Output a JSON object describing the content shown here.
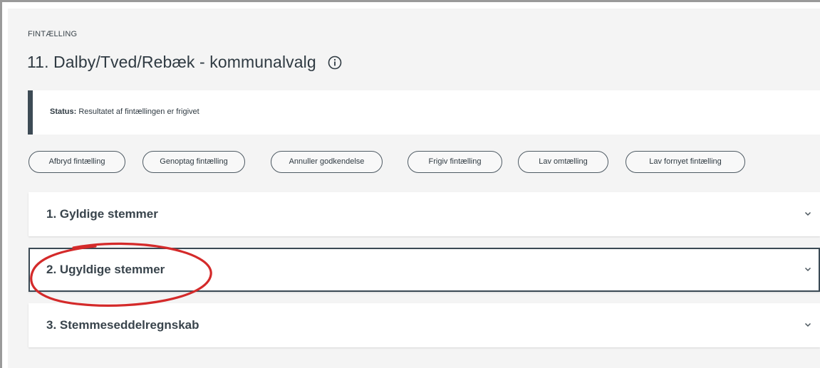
{
  "header": {
    "eyebrow": "FINTÆLLING",
    "title": "11. Dalby/Tved/Rebæk - kommunalvalg"
  },
  "status": {
    "label": "Status:",
    "text": " Resultatet af fintællingen er frigivet"
  },
  "actions": [
    {
      "label": "Afbryd fintælling"
    },
    {
      "label": "Genoptag fintælling"
    },
    {
      "label": "Annuller godkendelse"
    },
    {
      "label": "Frigiv fintælling"
    },
    {
      "label": "Lav omtælling"
    },
    {
      "label": "Lav fornyet fintælling"
    }
  ],
  "sections": [
    {
      "title": "1. Gyldige stemmer",
      "expanded": false
    },
    {
      "title": "2. Ugyldige stemmer",
      "expanded": false,
      "selected": true
    },
    {
      "title": "3. Stemmeseddelregnskab",
      "expanded": false
    }
  ],
  "icons": {
    "info": "info-icon",
    "chevron": "chevron-down-icon"
  },
  "colors": {
    "panel_bg": "#f4f4f4",
    "status_accent": "#3d4b55",
    "text": "#2f3a42",
    "annotation": "#d42a2a"
  }
}
